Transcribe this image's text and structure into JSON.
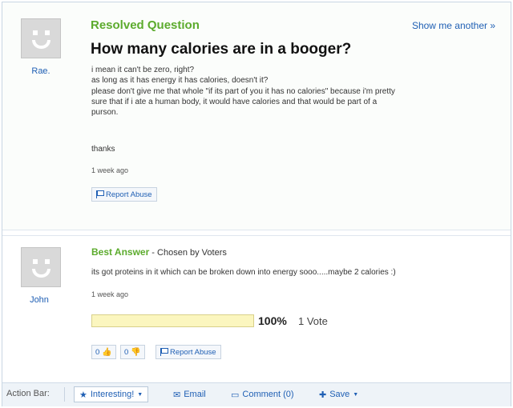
{
  "question": {
    "status": "Resolved Question",
    "show_another": "Show me another »",
    "title": "How many calories are in a booger?",
    "asker": "Rae.",
    "body_lines": [
      "i mean it can't be zero, right?",
      "as long as it has energy it has calories, doesn't it?",
      "please don't give me that whole \"if its part of you it has no calories\" because i'm pretty",
      "sure that if i ate a human body, it would have calories and that would be part of a",
      "purson."
    ],
    "thanks": "thanks",
    "time": "1 week ago",
    "report_abuse": "Report Abuse"
  },
  "answer": {
    "label": "Best Answer",
    "chosen_by": " - Chosen by Voters",
    "answerer": "John",
    "body": "its got proteins in it which can be broken down into energy sooo.....maybe 2 calories :)",
    "time": "1 week ago",
    "vote_percent": "100%",
    "vote_fraction": 1.0,
    "vote_count": "1 Vote",
    "thumbs_up_count": "0",
    "thumbs_down_count": "0",
    "report_abuse": "Report Abuse"
  },
  "action_bar": {
    "label": "Action Bar:",
    "interesting": "Interesting!",
    "email": "Email",
    "comment": "Comment (0)",
    "save": "Save"
  },
  "icons": {
    "star": "★",
    "envelope": "✉",
    "comment": "▭",
    "save": "✚",
    "caret": "▼",
    "thumb_up": "👍",
    "thumb_down": "👎"
  },
  "colors": {
    "accent_green": "#5cab2d",
    "link_blue": "#1f5fb4",
    "vote_bar": "#fbf6bf"
  }
}
